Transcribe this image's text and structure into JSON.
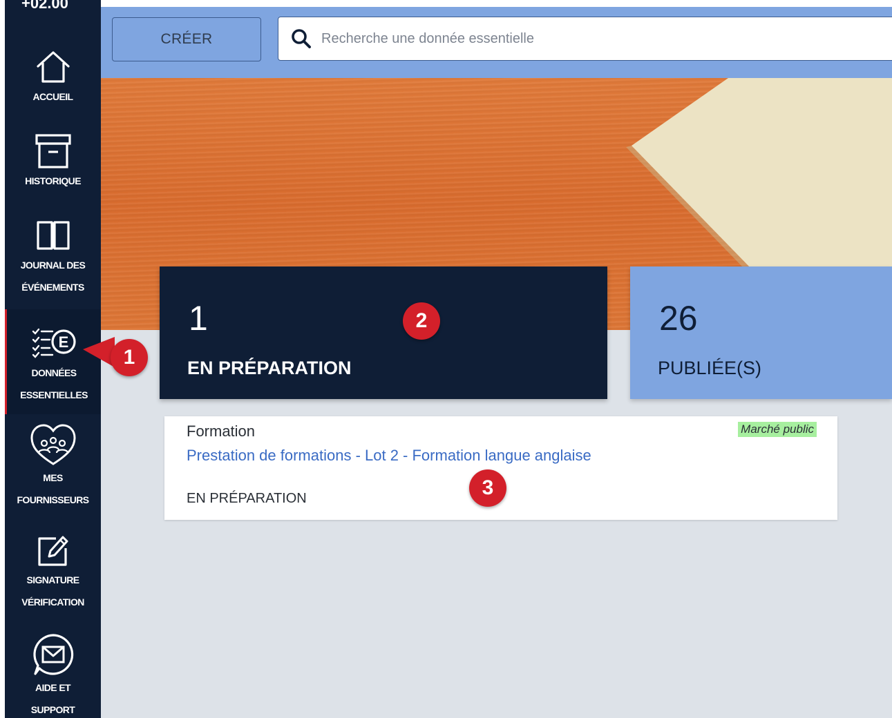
{
  "sidebar": {
    "top_text": "+02.00",
    "items": [
      {
        "label_lines": [
          "ACCUEIL"
        ],
        "icon": "home-icon"
      },
      {
        "label_lines": [
          "HISTORIQUE"
        ],
        "icon": "archive-box-icon"
      },
      {
        "label_lines": [
          "JOURNAL DES",
          "ÉVÉNEMENTS"
        ],
        "icon": "open-book-icon"
      },
      {
        "label_lines": [
          "DONNÉES",
          "ESSENTIELLES"
        ],
        "icon": "checklist-e-icon",
        "active": true
      },
      {
        "label_lines": [
          "MES",
          "FOURNISSEURS"
        ],
        "icon": "suppliers-group-icon"
      },
      {
        "label_lines": [
          "SIGNATURE",
          "VÉRIFICATION"
        ],
        "icon": "edit-signature-icon"
      },
      {
        "label_lines": [
          "AIDE ET",
          "SUPPORT"
        ],
        "icon": "mail-support-icon"
      }
    ]
  },
  "topbar": {
    "create_label": "CRÉER",
    "search_placeholder": "Recherche une donnée essentielle"
  },
  "stats": {
    "in_preparation": {
      "count": "1",
      "label": "EN PRÉPARATION"
    },
    "published": {
      "count": "26",
      "label": "PUBLIÉE(S)"
    }
  },
  "result": {
    "category": "Formation",
    "title": "Prestation de formations - Lot 2 - Formation langue anglaise",
    "status": "EN PRÉPARATION",
    "badge": "Marché public"
  },
  "markers": [
    "1",
    "2",
    "3"
  ],
  "colors": {
    "sidebar_bg": "#0f1e36",
    "accent_blue": "#7fa5e0",
    "link_blue": "#3a6bc4",
    "marker_red": "#d3202a",
    "badge_green": "#a7ef9f"
  }
}
